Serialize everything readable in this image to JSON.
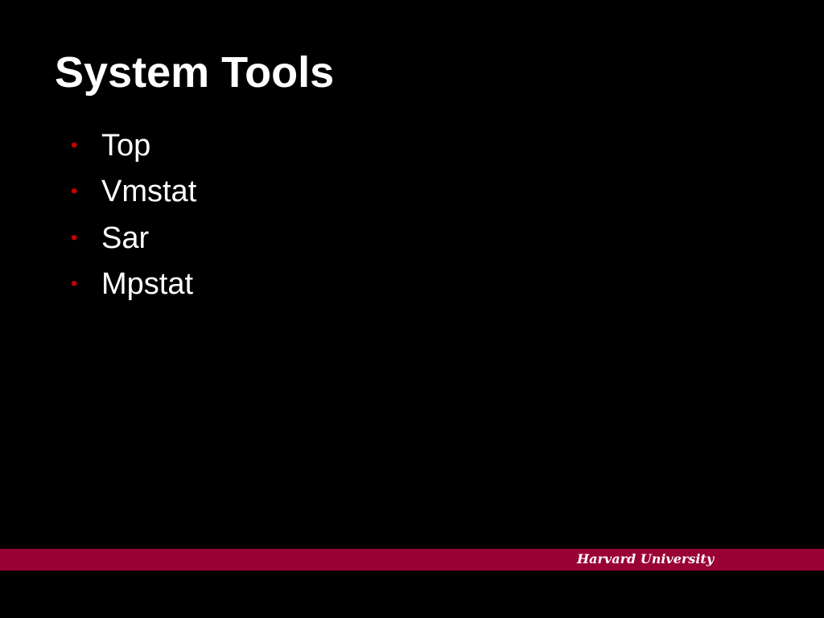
{
  "slide": {
    "title": "System Tools",
    "bullets": [
      {
        "text": "Top"
      },
      {
        "text": "Vmstat"
      },
      {
        "text": "Sar"
      },
      {
        "text": "Mpstat"
      }
    ]
  },
  "footer": {
    "brand": "Harvard University"
  },
  "theme": {
    "background": "#000000",
    "text": "#ffffff",
    "bullet": "#cc0000",
    "footer_band": "#990033"
  }
}
